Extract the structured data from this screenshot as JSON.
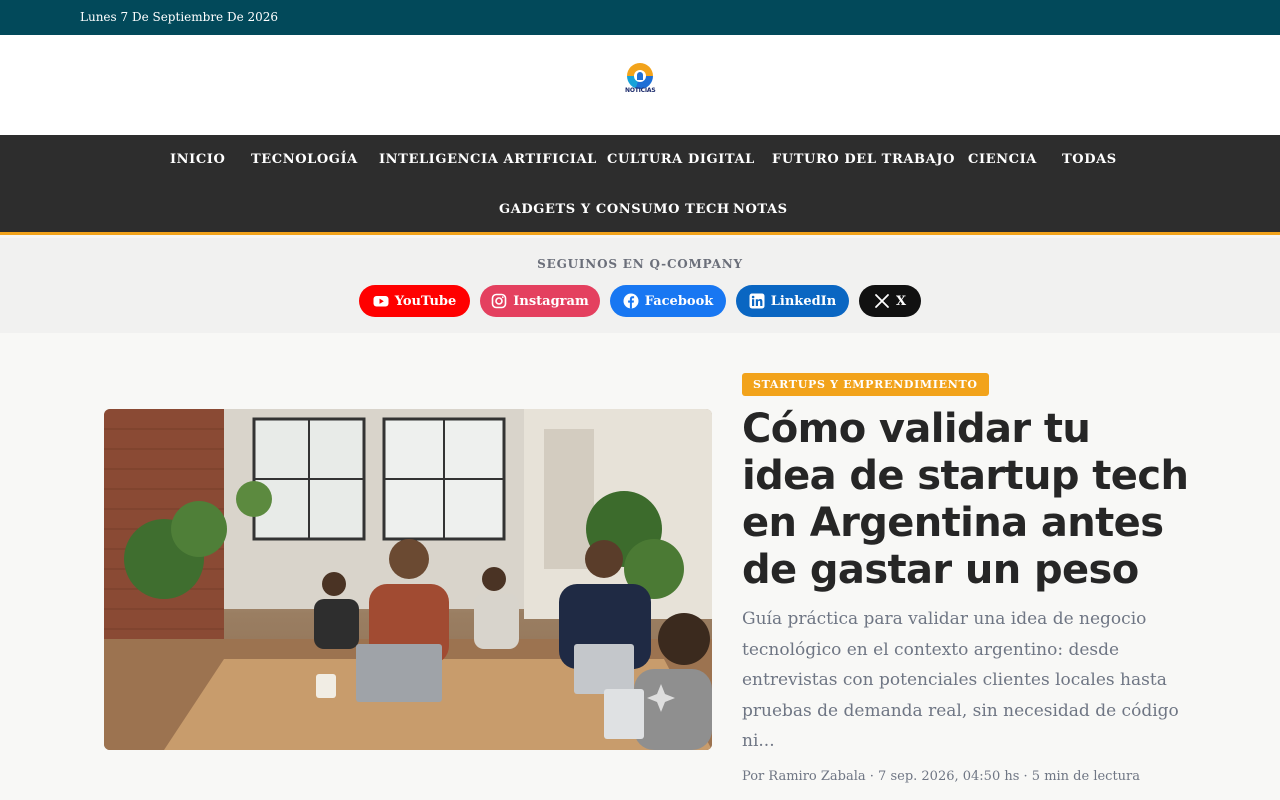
{
  "topbar": {
    "date": "Lunes 7 De Septiembre De 2026"
  },
  "logo": {
    "text": "NOTICIAS"
  },
  "nav": {
    "items": [
      {
        "label": "INICIO"
      },
      {
        "label": "TECNOLOGÍA"
      },
      {
        "label": "INTELIGENCIA ARTIFICIAL"
      },
      {
        "label": "CULTURA DIGITAL"
      },
      {
        "label": "FUTURO DEL TRABAJO"
      },
      {
        "label": "CIENCIA"
      },
      {
        "label": "TODAS"
      },
      {
        "label": "GADGETS Y CONSUMO TECH"
      },
      {
        "label": "NOTAS"
      }
    ],
    "accent_color": "#f2a31b"
  },
  "social": {
    "title": "SEGUINOS EN Q-COMPANY",
    "buttons": [
      {
        "label": "YouTube",
        "icon": "youtube-icon",
        "color": "#ff0000"
      },
      {
        "label": "Instagram",
        "icon": "instagram-icon",
        "color": "#e4405f"
      },
      {
        "label": "Facebook",
        "icon": "facebook-icon",
        "color": "#1877f2"
      },
      {
        "label": "LinkedIn",
        "icon": "linkedin-icon",
        "color": "#0a66c2"
      },
      {
        "label": "X",
        "icon": "x-icon",
        "color": "#111111"
      }
    ]
  },
  "article": {
    "category": "STARTUPS Y EMPRENDIMIENTO",
    "title": "Cómo validar tu idea de startup tech en Argentina antes de gastar un peso",
    "summary": "Guía práctica para validar una idea de negocio tecnológico en el contexto argentino: desde entrevistas con potenciales clientes locales hasta pruebas de demanda real, sin necesidad de código ni...",
    "meta": "Por Ramiro Zabala · 7 sep. 2026, 04:50 hs · 5 min de lectura"
  }
}
